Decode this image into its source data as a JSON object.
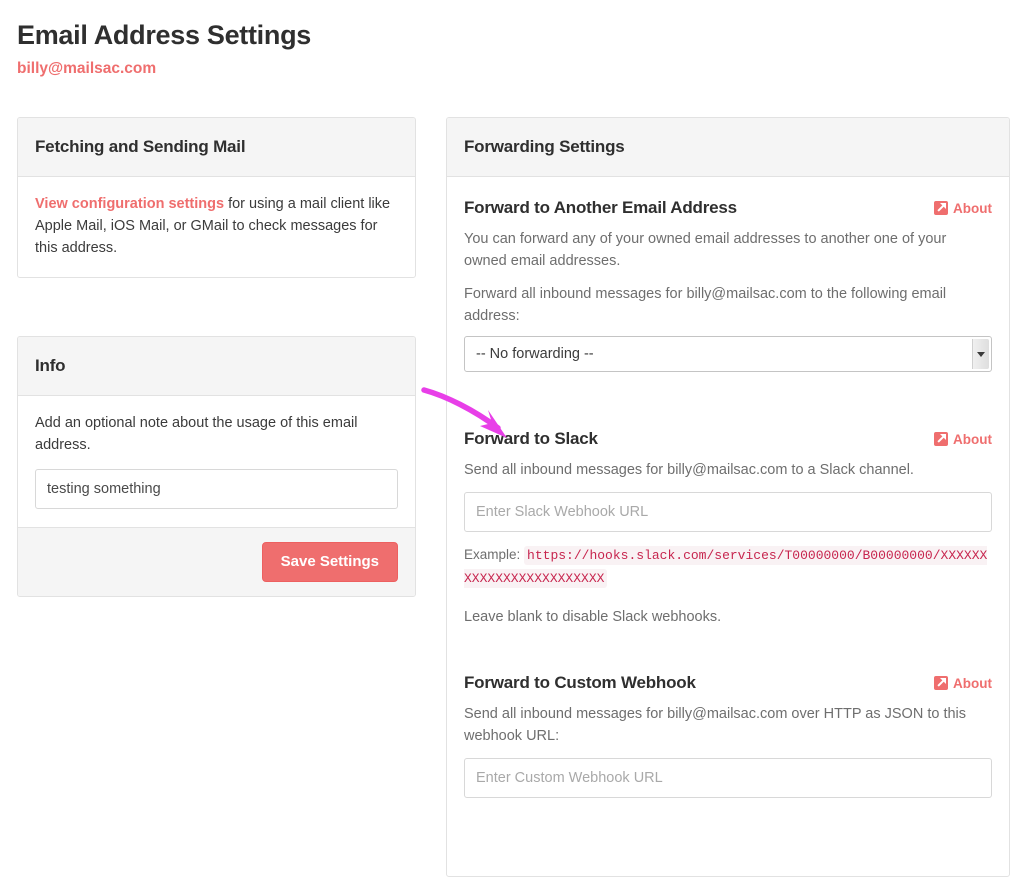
{
  "header": {
    "title": "Email Address Settings",
    "email": "billy@mailsac.com"
  },
  "left_column": {
    "fetching_panel": {
      "heading": "Fetching and Sending Mail",
      "link_text": "View configuration settings",
      "body_rest": " for using a mail client like Apple Mail, iOS Mail, or GMail to check messages for this address."
    },
    "info_panel": {
      "heading": "Info",
      "description": "Add an optional note about the usage of this email address.",
      "note_value": "testing something",
      "note_placeholder": "",
      "save_button": "Save Settings"
    }
  },
  "right_column": {
    "panel_heading": "Forwarding Settings",
    "about_label": "About",
    "about_icon": "external-link-icon",
    "sections": [
      {
        "title": "Forward to Another Email Address",
        "desc1": "You can forward any of your owned email addresses to another one of your owned email addresses.",
        "desc2": "Forward all inbound messages for billy@mailsac.com to the following email address:",
        "select_value": "-- No forwarding --",
        "select_icon": "chevron-down-icon"
      },
      {
        "title": "Forward to Slack",
        "desc1": "Send all inbound messages for billy@mailsac.com to a Slack channel.",
        "input_placeholder": "Enter Slack Webhook URL",
        "input_value": "",
        "example_label": "Example:",
        "example_url": "https://hooks.slack.com/services/T00000000/B00000000/XXXXXXXXXXXXXXXXXXXXXXXX",
        "hint": "Leave blank to disable Slack webhooks."
      },
      {
        "title": "Forward to Custom Webhook",
        "desc1": "Send all inbound messages for billy@mailsac.com over HTTP as JSON to this webhook URL:",
        "input_placeholder": "Enter Custom Webhook URL",
        "input_value": ""
      }
    ]
  },
  "annotation": {
    "type": "curved-arrow",
    "color": "#e83fe8",
    "points_to": "Forward to Slack section"
  },
  "colors": {
    "accent": "#ef6e6e",
    "panel_header_bg": "#f5f5f5",
    "border": "#e2e2e2",
    "code_text": "#c7254e",
    "code_bg": "#f9f2f4",
    "annotation": "#e83fe8"
  }
}
